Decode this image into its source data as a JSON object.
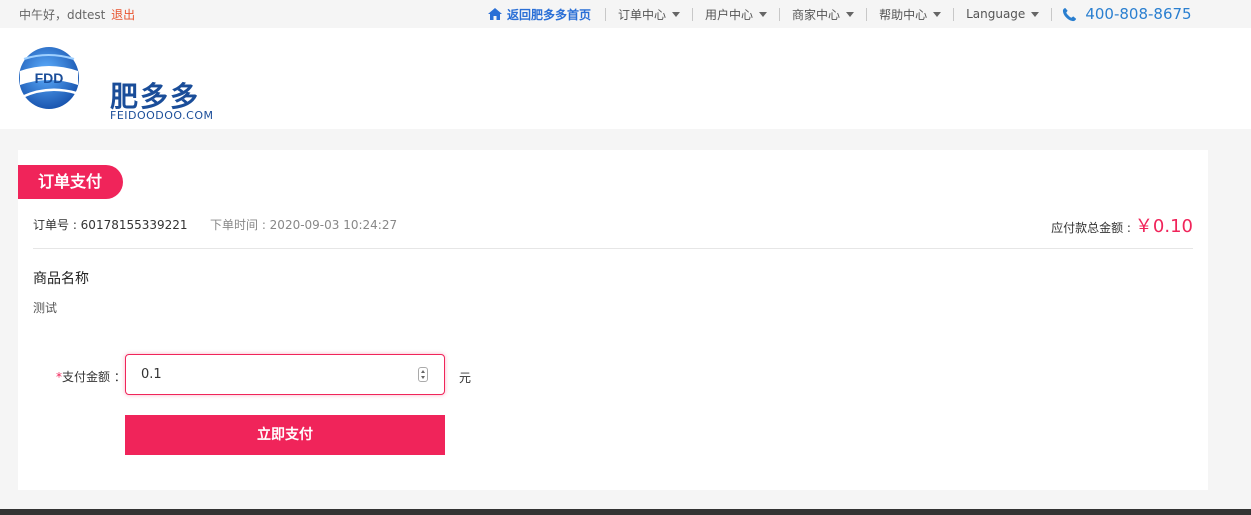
{
  "topbar": {
    "greeting": "中午好，ddtest",
    "logout": "退出",
    "home_link": "返回肥多多首页",
    "nav": [
      "订单中心",
      "用户中心",
      "商家中心",
      "帮助中心",
      "Language"
    ],
    "phone": "400-808-8675"
  },
  "header": {
    "logo_letters": "FDD",
    "brand_cn": "肥多多",
    "brand_en": "FEIDOODOO.COM"
  },
  "order": {
    "section_title": "订单支付",
    "order_no": "订单号 : 60178155339221",
    "order_time": "下单时间 : 2020-09-03 10:24:27",
    "total_label": "应付款总金额 :",
    "total_amount": "￥0.10",
    "product_label": "商品名称",
    "product_name": "测试"
  },
  "payment": {
    "required_mark": "*",
    "amount_label": "支付金额 ：",
    "amount_value": "0.1",
    "unit": "元",
    "pay_button": "立即支付"
  },
  "colors": {
    "accent": "#f0245a",
    "link_blue": "#2a6fd6",
    "brand_blue": "#1a4d99"
  }
}
